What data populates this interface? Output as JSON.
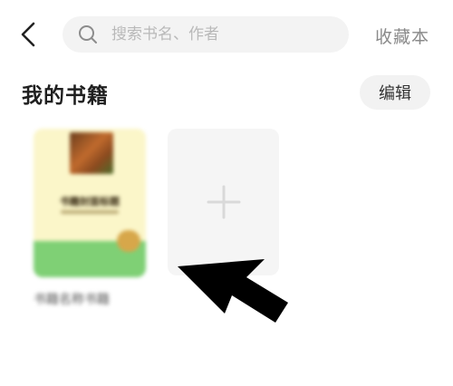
{
  "header": {
    "search_placeholder": "搜索书名、作者",
    "collection_label": "收藏本"
  },
  "section": {
    "title": "我的书籍",
    "edit_label": "编辑"
  },
  "books": [
    {
      "cover_title": "书籍封面标题",
      "name": "书籍名称书籍"
    }
  ],
  "icons": {
    "back": "chevron-left-icon",
    "search": "search-icon",
    "add": "plus-icon",
    "annotation": "arrow-icon"
  },
  "colors": {
    "background": "#ffffff",
    "search_bg": "#f3f3f3",
    "add_tile_bg": "#f5f5f5",
    "book_cover_top": "#fbf6c9",
    "book_cover_bottom": "#7fd075",
    "arrow": "#000000"
  }
}
